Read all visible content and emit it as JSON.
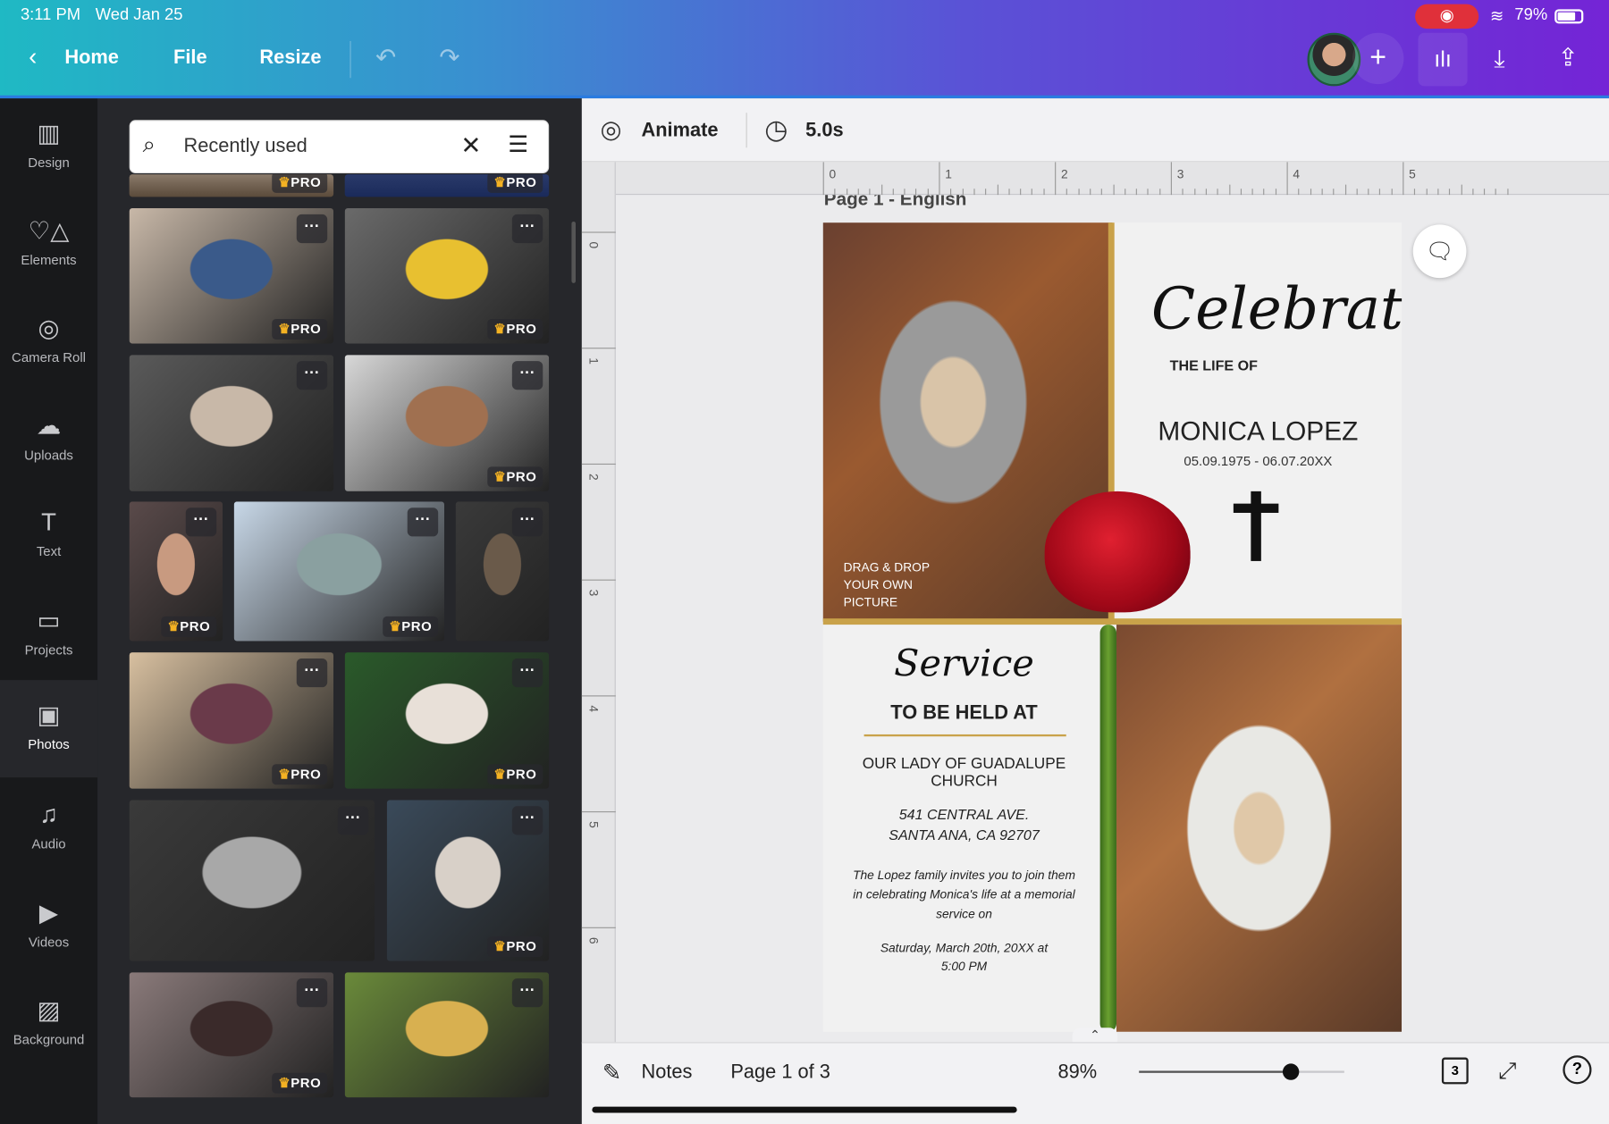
{
  "status_bar": {
    "time": "3:11 PM",
    "date": "Wed Jan 25",
    "battery": "79%"
  },
  "topbar": {
    "home": "Home",
    "file": "File",
    "resize": "Resize"
  },
  "rail": [
    {
      "label": "Design",
      "icon": "layout-icon"
    },
    {
      "label": "Elements",
      "icon": "shapes-icon"
    },
    {
      "label": "Camera Roll",
      "icon": "camera-icon"
    },
    {
      "label": "Uploads",
      "icon": "cloud-upload-icon"
    },
    {
      "label": "Text",
      "icon": "text-icon"
    },
    {
      "label": "Projects",
      "icon": "folder-icon"
    },
    {
      "label": "Photos",
      "icon": "image-icon"
    },
    {
      "label": "Audio",
      "icon": "music-icon"
    },
    {
      "label": "Videos",
      "icon": "video-icon"
    },
    {
      "label": "Background",
      "icon": "pattern-icon"
    }
  ],
  "search": {
    "value": "Recently used"
  },
  "pro_label": "PRO",
  "editor": {
    "animate": "Animate",
    "duration": "5.0s",
    "page_label": "Page 1 - English"
  },
  "ruler": {
    "h": [
      "0",
      "1",
      "2",
      "3",
      "4",
      "5"
    ],
    "v": [
      "0",
      "1",
      "2",
      "3",
      "4",
      "5",
      "6"
    ]
  },
  "design": {
    "celebrating": "Celebrating",
    "life_of": "THE LIFE OF",
    "name": "MONICA LOPEZ",
    "dates": "05.09.1975 - 06.07.20XX",
    "drag_drop": [
      "DRAG & DROP",
      "YOUR OWN",
      "PICTURE"
    ],
    "service": "Service",
    "held_at": "TO BE HELD AT",
    "church": [
      "OUR LADY OF GUADALUPE",
      "CHURCH"
    ],
    "address": [
      "541 CENTRAL AVE.",
      "SANTA ANA, CA 92707"
    ],
    "invite": [
      "The Lopez family invites you to join them",
      "in celebrating Monica's life at a memorial",
      "service on"
    ],
    "when": [
      "Saturday, March 20th, 20XX at",
      "5:00 PM"
    ]
  },
  "bottombar": {
    "notes": "Notes",
    "page": "Page 1 of 3",
    "zoom": "89%",
    "zoom_level": 0.74,
    "pages_count": "3"
  },
  "colors": {
    "accent_gold": "#c9a24a",
    "record_red": "#e0303a"
  }
}
